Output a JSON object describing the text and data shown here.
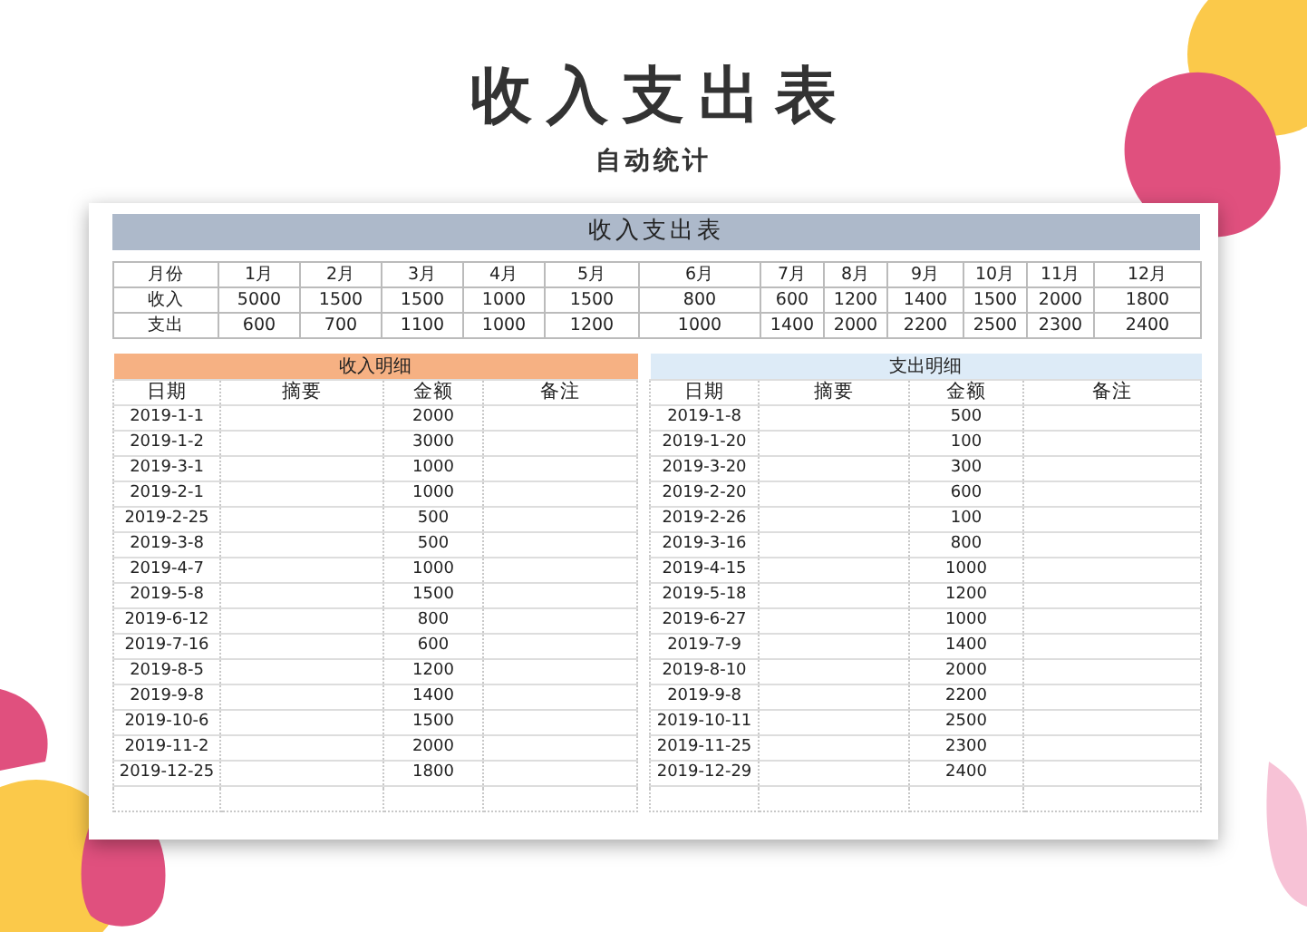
{
  "title": "收入支出表",
  "subtitle": "自动统计",
  "sheet": {
    "title": "收入支出表",
    "summary": {
      "columns": [
        "月份",
        "1月",
        "2月",
        "3月",
        "4月",
        "5月",
        "6月",
        "7月",
        "8月",
        "9月",
        "10月",
        "11月",
        "12月"
      ],
      "rows": [
        {
          "label": "收入",
          "values": [
            "5000",
            "1500",
            "1500",
            "1000",
            "1500",
            "800",
            "600",
            "1200",
            "1400",
            "1500",
            "2000",
            "1800"
          ]
        },
        {
          "label": "支出",
          "values": [
            "600",
            "700",
            "1100",
            "1000",
            "1200",
            "1000",
            "1400",
            "2000",
            "2200",
            "2500",
            "2300",
            "2400"
          ]
        }
      ]
    },
    "details": [
      {
        "title": "收入明细",
        "color": "#f6b183",
        "columns": [
          "日期",
          "摘要",
          "金额",
          "备注"
        ],
        "rows": [
          {
            "date": "2019-1-1",
            "amount": "2000"
          },
          {
            "date": "2019-1-2",
            "amount": "3000"
          },
          {
            "date": "2019-3-1",
            "amount": "1000"
          },
          {
            "date": "2019-2-1",
            "amount": "1000"
          },
          {
            "date": "2019-2-25",
            "amount": "500"
          },
          {
            "date": "2019-3-8",
            "amount": "500"
          },
          {
            "date": "2019-4-7",
            "amount": "1000"
          },
          {
            "date": "2019-5-8",
            "amount": "1500"
          },
          {
            "date": "2019-6-12",
            "amount": "800"
          },
          {
            "date": "2019-7-16",
            "amount": "600"
          },
          {
            "date": "2019-8-5",
            "amount": "1200"
          },
          {
            "date": "2019-9-8",
            "amount": "1400"
          },
          {
            "date": "2019-10-6",
            "amount": "1500"
          },
          {
            "date": "2019-11-2",
            "amount": "2000"
          },
          {
            "date": "2019-12-25",
            "amount": "1800"
          }
        ]
      },
      {
        "title": "支出明细",
        "color": "#ddebf7",
        "columns": [
          "日期",
          "摘要",
          "金额",
          "备注"
        ],
        "rows": [
          {
            "date": "2019-1-8",
            "amount": "500"
          },
          {
            "date": "2019-1-20",
            "amount": "100"
          },
          {
            "date": "2019-3-20",
            "amount": "300"
          },
          {
            "date": "2019-2-20",
            "amount": "600"
          },
          {
            "date": "2019-2-26",
            "amount": "100"
          },
          {
            "date": "2019-3-16",
            "amount": "800"
          },
          {
            "date": "2019-4-15",
            "amount": "1000"
          },
          {
            "date": "2019-5-18",
            "amount": "1200"
          },
          {
            "date": "2019-6-27",
            "amount": "1000"
          },
          {
            "date": "2019-7-9",
            "amount": "1400"
          },
          {
            "date": "2019-8-10",
            "amount": "2000"
          },
          {
            "date": "2019-9-8",
            "amount": "2200"
          },
          {
            "date": "2019-10-11",
            "amount": "2500"
          },
          {
            "date": "2019-11-25",
            "amount": "2300"
          },
          {
            "date": "2019-12-29",
            "amount": "2400"
          }
        ]
      }
    ]
  }
}
